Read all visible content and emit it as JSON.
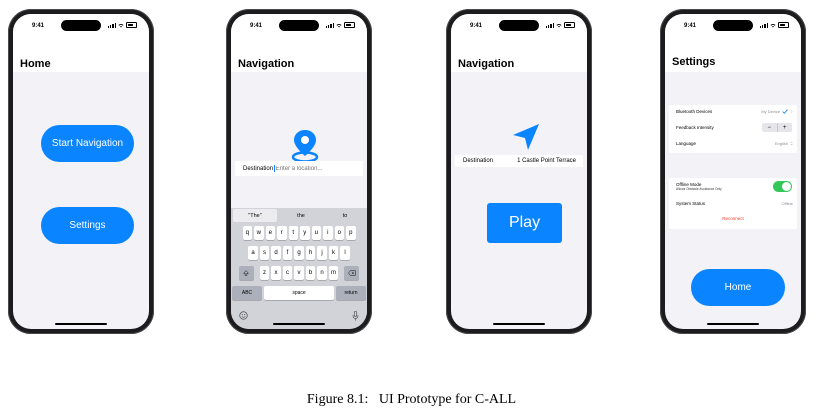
{
  "status": {
    "time": "9:41"
  },
  "screens": {
    "home": {
      "title": "Home",
      "start_navigation_label": "Start Navigation",
      "settings_label": "Settings"
    },
    "navigation_input": {
      "title": "Navigation",
      "destination_label": "Destination",
      "destination_placeholder": "Enter a location...",
      "keyboard": {
        "suggestions": [
          "\"The\"",
          "the",
          "to"
        ],
        "row1": [
          "q",
          "w",
          "e",
          "r",
          "t",
          "y",
          "u",
          "i",
          "o",
          "p"
        ],
        "row2": [
          "a",
          "s",
          "d",
          "f",
          "g",
          "h",
          "j",
          "k",
          "l"
        ],
        "row3": [
          "z",
          "x",
          "c",
          "v",
          "b",
          "n",
          "m"
        ],
        "abc_label": "ABC",
        "space_label": "space",
        "return_label": "return"
      }
    },
    "navigation_play": {
      "title": "Navigation",
      "destination_label": "Destination",
      "destination_value": "1 Castle Point Terrace",
      "play_label": "Play"
    },
    "settings": {
      "title": "Settings",
      "bluetooth_label": "Bluetooth Devices",
      "bluetooth_value": "My Device",
      "feedback_label": "Feedback Intensity",
      "minus_label": "−",
      "plus_label": "+",
      "language_label": "Language",
      "language_value": "English",
      "offline_label": "Offline Mode",
      "offline_sub": "Allows Obstacle Avoidance Only",
      "offline_on": true,
      "system_status_label": "System Status",
      "system_status_value": "Offline",
      "reconnect_label": "Reconnect",
      "home_label": "Home"
    }
  },
  "caption": "Figure 8.1:   UI Prototype for C-ALL",
  "colors": {
    "accent": "#0a84ff",
    "toggle_on": "#34c759",
    "reconnect": "#ff3b30"
  }
}
